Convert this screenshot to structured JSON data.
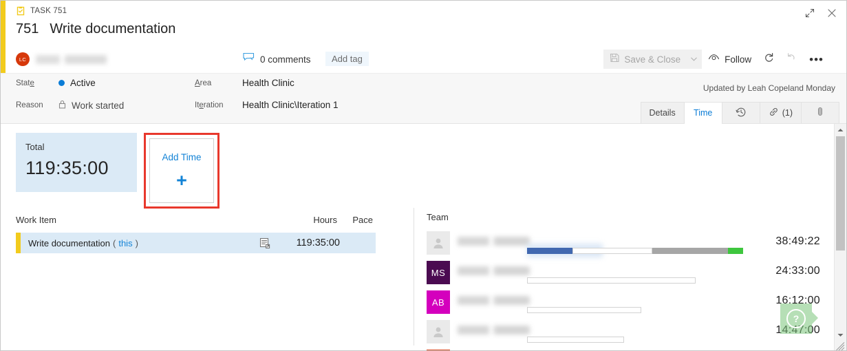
{
  "window": {
    "expand_tooltip": "Expand",
    "close_tooltip": "Close"
  },
  "header": {
    "work_item_type": "TASK 751",
    "type_icon": "task-clipboard-icon",
    "id": "751",
    "title": "Write documentation",
    "assignee_initials": "LC",
    "comments_label": "0 comments",
    "comments_icon": "comment-icon",
    "add_tag_label": "Add tag"
  },
  "toolbar": {
    "save_close_label": "Save & Close",
    "save_icon": "save-disk-icon",
    "save_caret_icon": "chevron-down-icon",
    "follow_label": "Follow",
    "follow_icon": "eye-icon",
    "refresh_icon": "refresh-icon",
    "undo_icon": "undo-icon",
    "more_icon": "ellipsis-icon"
  },
  "fields": {
    "state_label": "State",
    "state_value": "Active",
    "state_color": "#0a7cd6",
    "reason_label": "Reason",
    "reason_value": "Work started",
    "reason_icon": "lock-icon",
    "area_label": "Area",
    "area_value": "Health Clinic",
    "iteration_label": "Iteration",
    "iteration_value": "Health Clinic\\Iteration 1",
    "updated_text": "Updated by Leah Copeland Monday"
  },
  "tabs": [
    {
      "label": "Details",
      "icon": "",
      "active": false
    },
    {
      "label": "Time",
      "icon": "",
      "active": true
    },
    {
      "label": "",
      "icon": "history-icon",
      "active": false
    },
    {
      "label": "",
      "icon": "link-icon",
      "count": "(1)",
      "active": false
    },
    {
      "label": "",
      "icon": "attachment-icon",
      "active": false
    }
  ],
  "time_tab": {
    "total_card": {
      "label": "Total",
      "value": "119:35:00",
      "background": "#dbeaf6"
    },
    "add_time_card": {
      "label": "Add Time",
      "plus_icon": "plus-icon",
      "highlight_color": "#e8382c"
    },
    "work_item_table": {
      "headers": [
        "Work Item",
        "Hours",
        "Pace"
      ],
      "rows": [
        {
          "name": "Write documentation",
          "this_label": "this",
          "row_icon": "report-icon",
          "hours": "119:35:00",
          "pace": "",
          "accent": "#f2cb1d"
        }
      ]
    },
    "team_panel": {
      "header": "Team",
      "members": [
        {
          "initials": "",
          "avatar_type": "generic",
          "avatar_color": "#eaeaea",
          "time": "38:49:22",
          "segments": [
            {
              "color": "#4168b0",
              "left_pct": 0,
              "width_pct": 21
            },
            {
              "color": "outline",
              "left_pct": 21,
              "width_pct": 37
            },
            {
              "color": "#a6a6a6",
              "left_pct": 58,
              "width_pct": 35
            },
            {
              "color": "#3ec63e",
              "left_pct": 93,
              "width_pct": 7
            }
          ]
        },
        {
          "initials": "MS",
          "avatar_type": "initials",
          "avatar_color": "#4b0b51",
          "time": "24:33:00",
          "segments": [
            {
              "color": "outline",
              "left_pct": 0,
              "width_pct": 78
            }
          ]
        },
        {
          "initials": "AB",
          "avatar_type": "initials",
          "avatar_color": "#d400bd",
          "time": "16:12:00",
          "segments": [
            {
              "color": "outline",
              "left_pct": 0,
              "width_pct": 53
            }
          ]
        },
        {
          "initials": "",
          "avatar_type": "generic",
          "avatar_color": "#eaeaea",
          "time": "14:47:00",
          "segments": [
            {
              "color": "outline",
              "left_pct": 0,
              "width_pct": 45
            }
          ]
        },
        {
          "initials": "",
          "avatar_type": "partial",
          "avatar_color": "#d6380b",
          "time": "",
          "segments": []
        }
      ]
    },
    "help_bubble": {
      "icon": "question-mark-icon",
      "color": "#7ac47a"
    }
  },
  "scrollbar": {
    "up_icon": "caret-up-icon",
    "down_icon": "caret-down-icon",
    "resize_grip": "resize-grip-icon"
  }
}
